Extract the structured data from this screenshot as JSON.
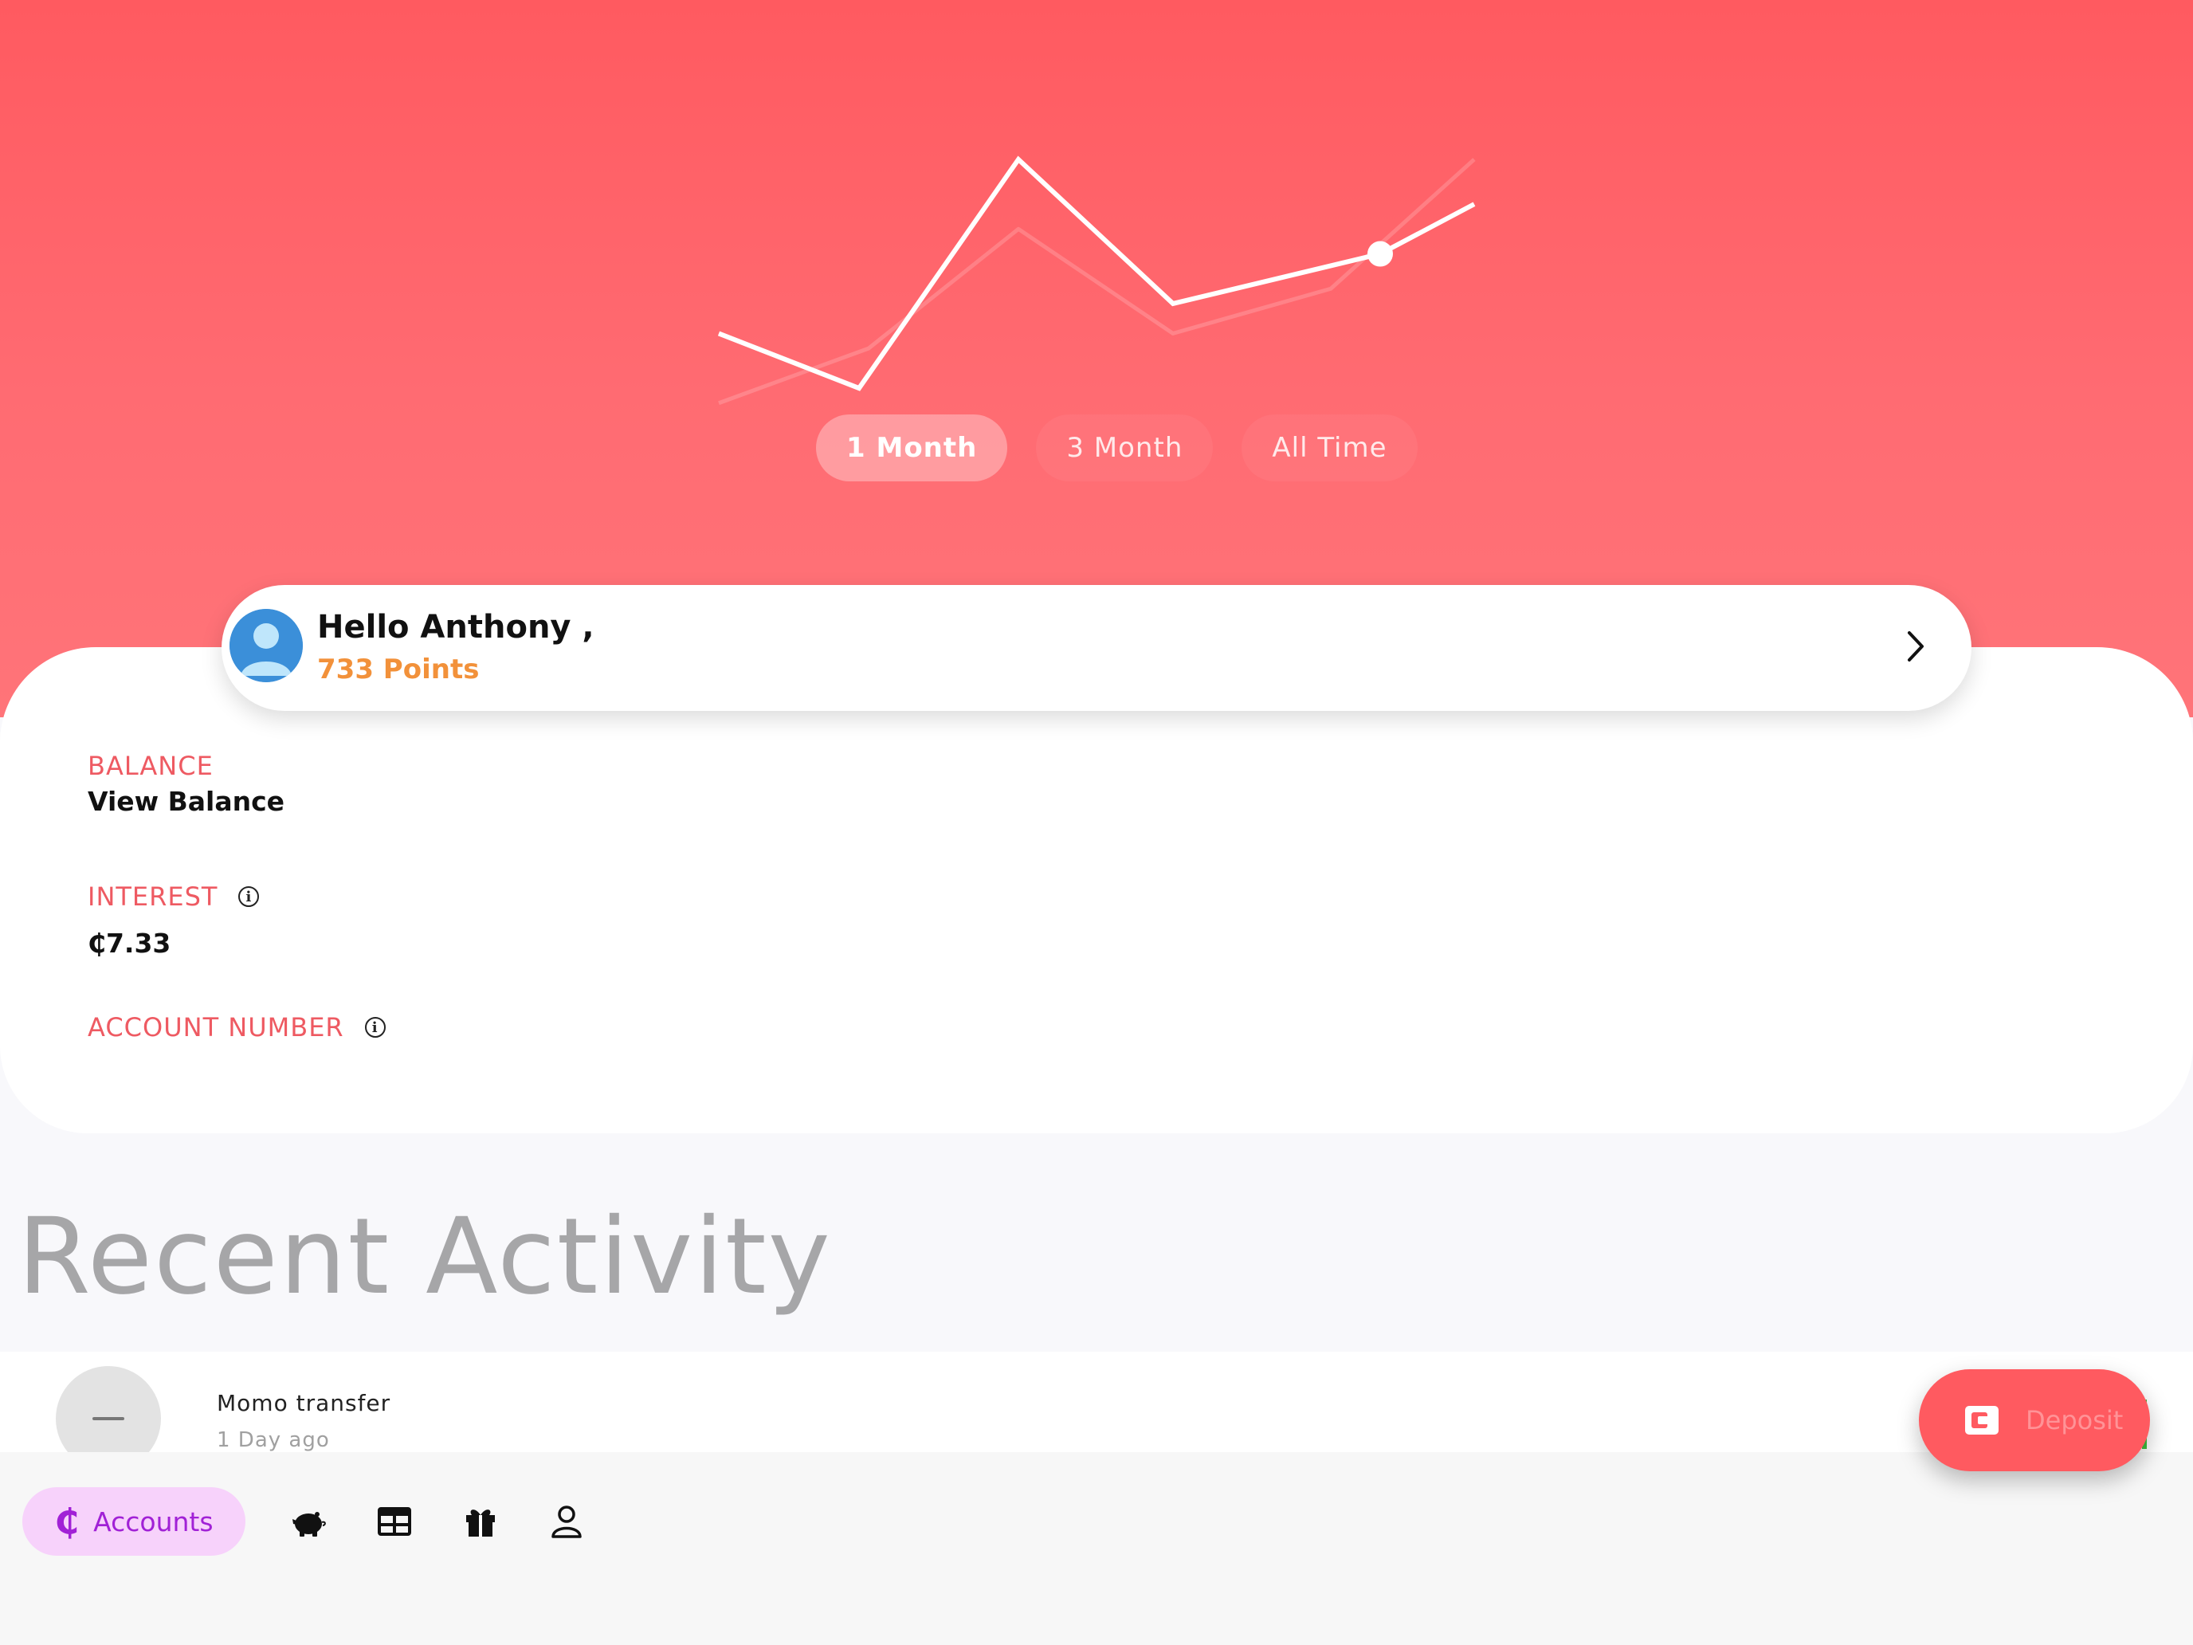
{
  "hero": {
    "range_tabs": [
      "1 Month",
      "3 Month",
      "All Time"
    ],
    "active_tab": "1 Month",
    "chart_data": {
      "type": "line",
      "series": [
        {
          "values": [
            30,
            8,
            100,
            42,
            62,
            82
          ],
          "highlight_index": 4
        },
        {
          "values": [
            2,
            24,
            72,
            30,
            48,
            100
          ]
        }
      ],
      "colors": {
        "line": "#ffffff",
        "shadow": "#ffffff"
      }
    }
  },
  "greeting": {
    "name_text": "Hello Anthony ,",
    "points_text": "733 Points"
  },
  "account": {
    "balance_label": "BALANCE",
    "balance_value": "View Balance",
    "interest_label": "INTEREST",
    "interest_value": "₵7.33",
    "account_number_label": "ACCOUNT NUMBER"
  },
  "recent": {
    "title": "Recent Activity",
    "items": [
      {
        "title": "Momo transfer",
        "time": "1 Day ago"
      }
    ]
  },
  "deposit": {
    "label": "Deposit"
  },
  "nav": {
    "accounts_label": "Accounts",
    "accounts_symbol": "₵",
    "icons": [
      "piggy-bank-icon",
      "table-icon",
      "gift-icon",
      "user-icon"
    ]
  },
  "colors": {
    "brand": "#ff5a60",
    "label_red": "#ee5a62",
    "points_orange": "#f2913a",
    "nav_active_bg": "#f7d2fb",
    "nav_active_text": "#a121d6"
  }
}
